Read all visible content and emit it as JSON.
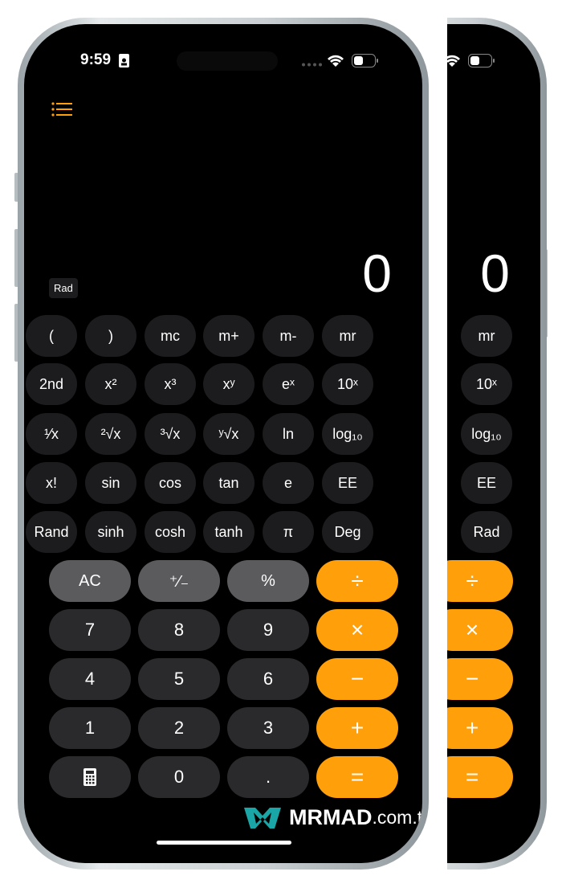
{
  "status": {
    "time": "9:59"
  },
  "menu_icon": "list-icon",
  "angle_mode": "Rad",
  "display_value": "0",
  "scientific_keys": [
    [
      "(",
      ")",
      "mc",
      "m+",
      "m-",
      "mr"
    ],
    [
      "2nd",
      "x²",
      "x³",
      "xʸ",
      "eˣ",
      "10ˣ"
    ],
    [
      "¹⁄x",
      "²√x",
      "³√x",
      "ʸ√x",
      "ln",
      "log₁₀"
    ],
    [
      "x!",
      "sin",
      "cos",
      "tan",
      "e",
      "EE"
    ],
    [
      "Rand",
      "sinh",
      "cosh",
      "tanh",
      "π",
      "Deg"
    ]
  ],
  "basic_keys": [
    [
      "AC",
      "⁺⁄₋",
      "%",
      "÷"
    ],
    [
      "7",
      "8",
      "9",
      "×"
    ],
    [
      "4",
      "5",
      "6",
      "−"
    ],
    [
      "1",
      "2",
      "3",
      "+"
    ],
    [
      "calculator-icon",
      "0",
      ".",
      "="
    ]
  ],
  "right_phone": {
    "scientific_column": [
      "mr",
      "10ˣ",
      "log₁₀",
      "EE",
      "Rad"
    ],
    "operators": [
      "÷",
      "×",
      "−",
      "+",
      "="
    ],
    "display_value": "0"
  },
  "watermark": {
    "brand": "MRMAD",
    "suffix": ".com.tw"
  },
  "colors": {
    "operator": "#ff9f0a",
    "function": "#5b5b5e",
    "number": "#2a2a2c",
    "scientific": "#1c1c1e",
    "menu": "#ff9f0a"
  }
}
